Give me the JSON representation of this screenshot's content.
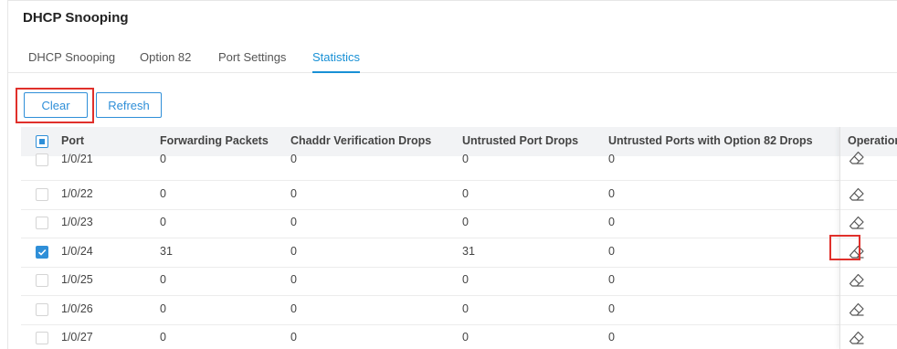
{
  "page": {
    "title": "DHCP Snooping"
  },
  "tabs": [
    {
      "label": "DHCP Snooping",
      "active": false
    },
    {
      "label": "Option 82",
      "active": false
    },
    {
      "label": "Port Settings",
      "active": false
    },
    {
      "label": "Statistics",
      "active": true
    }
  ],
  "toolbar": {
    "clear_label": "Clear",
    "refresh_label": "Refresh"
  },
  "table": {
    "headers": {
      "port": "Port",
      "forwarding": "Forwarding Packets",
      "chaddr": "Chaddr Verification Drops",
      "untrusted": "Untrusted Port Drops",
      "untrusted82": "Untrusted Ports with Option 82 Drops",
      "operation": "Operation"
    },
    "rows": [
      {
        "port": "1/0/21",
        "forwarding": "0",
        "chaddr": "0",
        "untrusted": "0",
        "untrusted82": "0",
        "checked": false
      },
      {
        "port": "1/0/22",
        "forwarding": "0",
        "chaddr": "0",
        "untrusted": "0",
        "untrusted82": "0",
        "checked": false
      },
      {
        "port": "1/0/23",
        "forwarding": "0",
        "chaddr": "0",
        "untrusted": "0",
        "untrusted82": "0",
        "checked": false
      },
      {
        "port": "1/0/24",
        "forwarding": "31",
        "chaddr": "0",
        "untrusted": "31",
        "untrusted82": "0",
        "checked": true
      },
      {
        "port": "1/0/25",
        "forwarding": "0",
        "chaddr": "0",
        "untrusted": "0",
        "untrusted82": "0",
        "checked": false
      },
      {
        "port": "1/0/26",
        "forwarding": "0",
        "chaddr": "0",
        "untrusted": "0",
        "untrusted82": "0",
        "checked": false
      },
      {
        "port": "1/0/27",
        "forwarding": "0",
        "chaddr": "0",
        "untrusted": "0",
        "untrusted82": "0",
        "checked": false
      }
    ],
    "operation_icon": "eraser-icon"
  },
  "colors": {
    "accent": "#2f8fd8",
    "highlight": "#e0302b",
    "header_bg": "#f2f3f5"
  }
}
